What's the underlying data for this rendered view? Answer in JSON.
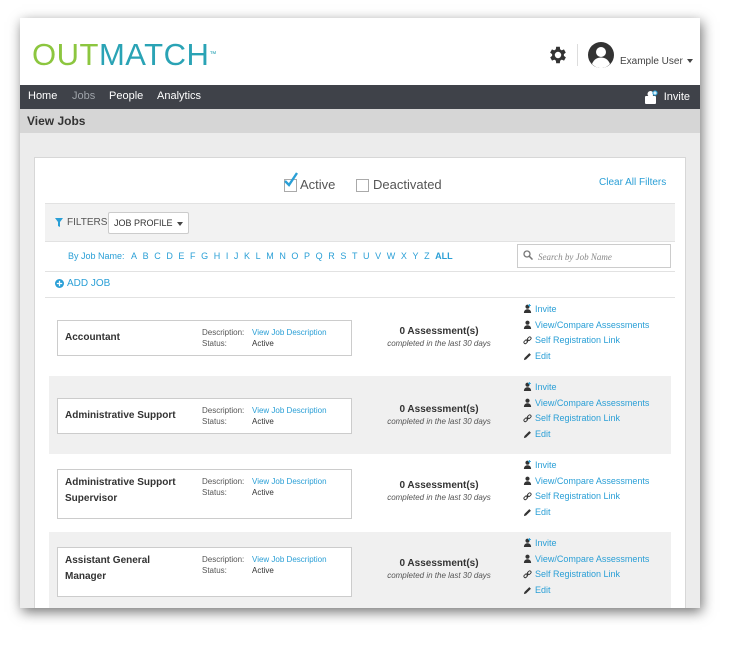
{
  "header": {
    "logo_out": "OUT",
    "logo_match": "MATCH",
    "logo_tm": "™",
    "user_name": "Example User"
  },
  "nav": {
    "items": [
      {
        "label": "Home"
      },
      {
        "label": "Jobs"
      },
      {
        "label": "People"
      },
      {
        "label": "Analytics"
      }
    ],
    "invite_label": "Invite"
  },
  "page": {
    "title": "View Jobs"
  },
  "status_filter": {
    "active_label": "Active",
    "active_checked": true,
    "deactivated_label": "Deactivated",
    "deactivated_checked": false,
    "clear_label": "Clear All Filters"
  },
  "filters": {
    "label": "FILTERS",
    "job_profile_label": "JOB PROFILE"
  },
  "alpha": {
    "label": "By Job Name:",
    "letters": [
      "A",
      "B",
      "C",
      "D",
      "E",
      "F",
      "G",
      "H",
      "I",
      "J",
      "K",
      "L",
      "M",
      "N",
      "O",
      "P",
      "Q",
      "R",
      "S",
      "T",
      "U",
      "V",
      "W",
      "X",
      "Y",
      "Z"
    ],
    "all_label": "ALL"
  },
  "search": {
    "placeholder": "Search by Job Name"
  },
  "add_job_label": "ADD JOB",
  "jobs": [
    {
      "name": "Accountant",
      "description_label": "Description:",
      "description_value": "View Job Description",
      "status_label": "Status:",
      "status_value": "Active",
      "assessment_count": "0 Assessment(s)",
      "assessment_sub": "completed in the last 30 days",
      "actions": [
        "Invite",
        "View/Compare Assessments",
        "Self Registration Link",
        "Edit"
      ]
    },
    {
      "name": "Administrative Support",
      "description_label": "Description:",
      "description_value": "View Job Description",
      "status_label": "Status:",
      "status_value": "Active",
      "assessment_count": "0 Assessment(s)",
      "assessment_sub": "completed in the last 30 days",
      "actions": [
        "Invite",
        "View/Compare Assessments",
        "Self Registration Link",
        "Edit"
      ]
    },
    {
      "name": "Administrative Support Supervisor",
      "description_label": "Description:",
      "description_value": "View Job Description",
      "status_label": "Status:",
      "status_value": "Active",
      "assessment_count": "0 Assessment(s)",
      "assessment_sub": "completed in the last 30 days",
      "actions": [
        "Invite",
        "View/Compare Assessments",
        "Self Registration Link",
        "Edit"
      ]
    },
    {
      "name": "Assistant General Manager",
      "description_label": "Description:",
      "description_value": "View Job Description",
      "status_label": "Status:",
      "status_value": "Active",
      "assessment_count": "0 Assessment(s)",
      "assessment_sub": "completed in the last 30 days",
      "actions": [
        "Invite",
        "View/Compare Assessments",
        "Self Registration Link",
        "Edit"
      ]
    }
  ],
  "colors": {
    "logo_green": "#8cc63f",
    "logo_teal": "#2aa3b5",
    "link_blue": "#2a9fd6",
    "navbar": "#3f4249",
    "checkmark": "#2a9fd6"
  }
}
